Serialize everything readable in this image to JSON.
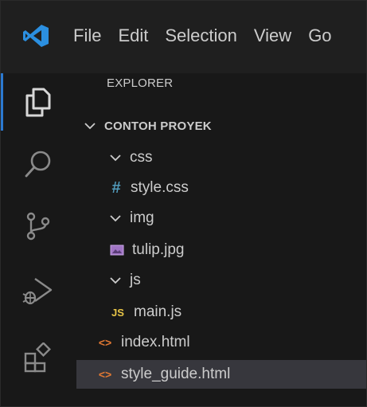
{
  "menu": {
    "items": [
      "File",
      "Edit",
      "Selection",
      "View",
      "Go"
    ]
  },
  "activity_bar": {
    "icons": [
      "files-icon",
      "search-icon",
      "source-control-icon",
      "run-debug-icon",
      "extensions-icon"
    ],
    "active": "files-icon"
  },
  "explorer": {
    "title": "EXPLORER",
    "root": "CONTOH PROYEK",
    "tree": [
      {
        "type": "folder",
        "name": "css",
        "expanded": true
      },
      {
        "type": "file",
        "name": "style.css",
        "icon": "css-file-icon"
      },
      {
        "type": "folder",
        "name": "img",
        "expanded": true
      },
      {
        "type": "file",
        "name": "tulip.jpg",
        "icon": "image-file-icon"
      },
      {
        "type": "folder",
        "name": "js",
        "expanded": true
      },
      {
        "type": "file",
        "name": "main.js",
        "icon": "js-file-icon"
      },
      {
        "type": "file",
        "name": "index.html",
        "icon": "html-file-icon"
      },
      {
        "type": "file",
        "name": "style_guide.html",
        "icon": "html-file-icon",
        "selected": true
      }
    ]
  },
  "colors": {
    "accent": "#2b79d1",
    "css_icon": "#519aba",
    "js_icon": "#e8c547",
    "html_icon": "#e37933",
    "image_icon": "#a074c4",
    "selected_row": "#37373d"
  }
}
